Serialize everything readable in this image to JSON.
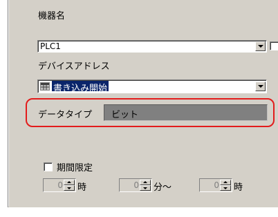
{
  "device": {
    "label": "機器名",
    "value": "PLC1"
  },
  "address": {
    "label": "デバイスアドレス",
    "value": "書き込み開始",
    "icon": "table-icon"
  },
  "data_type": {
    "label": "データタイプ",
    "value": "ビット",
    "highlight_color": "#e31b1b"
  },
  "period": {
    "checkbox_label": "期間限定",
    "checked": false,
    "spinners": [
      {
        "value": "0",
        "unit": "時"
      },
      {
        "value": "0",
        "unit": "分〜"
      },
      {
        "value": "0",
        "unit": "時"
      }
    ]
  }
}
